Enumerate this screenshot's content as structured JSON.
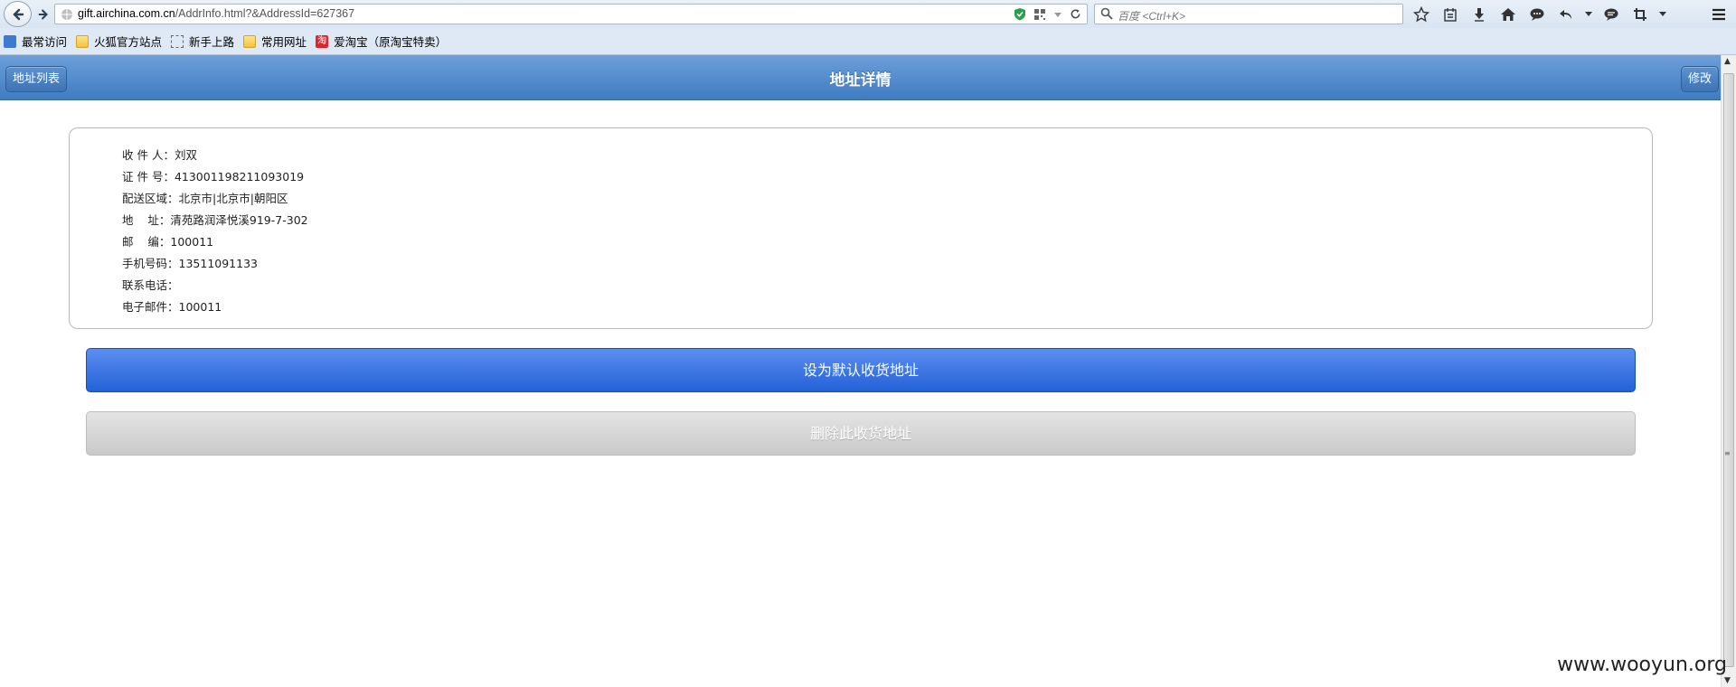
{
  "browser": {
    "url_domain": "gift.airchina.com.cn",
    "url_path": "/AddrInfo.html?&AddressId=627367",
    "search_placeholder": "百度 <Ctrl+K>",
    "bookmarks": [
      {
        "label": "最常访问",
        "icon": "bookmark-icon"
      },
      {
        "label": "火狐官方站点",
        "icon": "folder-icon"
      },
      {
        "label": "新手上路",
        "icon": "dashed-box-icon"
      },
      {
        "label": "常用网址",
        "icon": "folder-icon"
      },
      {
        "label": "爱淘宝（原淘宝特卖）",
        "icon": "taobao-icon",
        "icon_text": "淘"
      }
    ]
  },
  "header": {
    "title": "地址详情",
    "left_button": "地址列表",
    "right_button": "修改",
    "color": "#4a86c8"
  },
  "details": [
    {
      "label": "收 件 人：",
      "value": "刘双"
    },
    {
      "label": "证 件 号：",
      "value": "413001198211093019"
    },
    {
      "label": "配送区域：",
      "value": "北京市|北京市|朝阳区"
    },
    {
      "label": "地    址：",
      "value": "清苑路润泽悦溪919-7-302"
    },
    {
      "label": "邮    编：",
      "value": "100011"
    },
    {
      "label": "手机号码：",
      "value": "13511091133"
    },
    {
      "label": "联系电话：",
      "value": ""
    },
    {
      "label": "电子邮件：",
      "value": "100011"
    }
  ],
  "actions": {
    "set_default": "设为默认收货地址",
    "delete": "删除此收货地址",
    "primary_color": "#2a66dc"
  },
  "watermark": "www.wooyun.org"
}
